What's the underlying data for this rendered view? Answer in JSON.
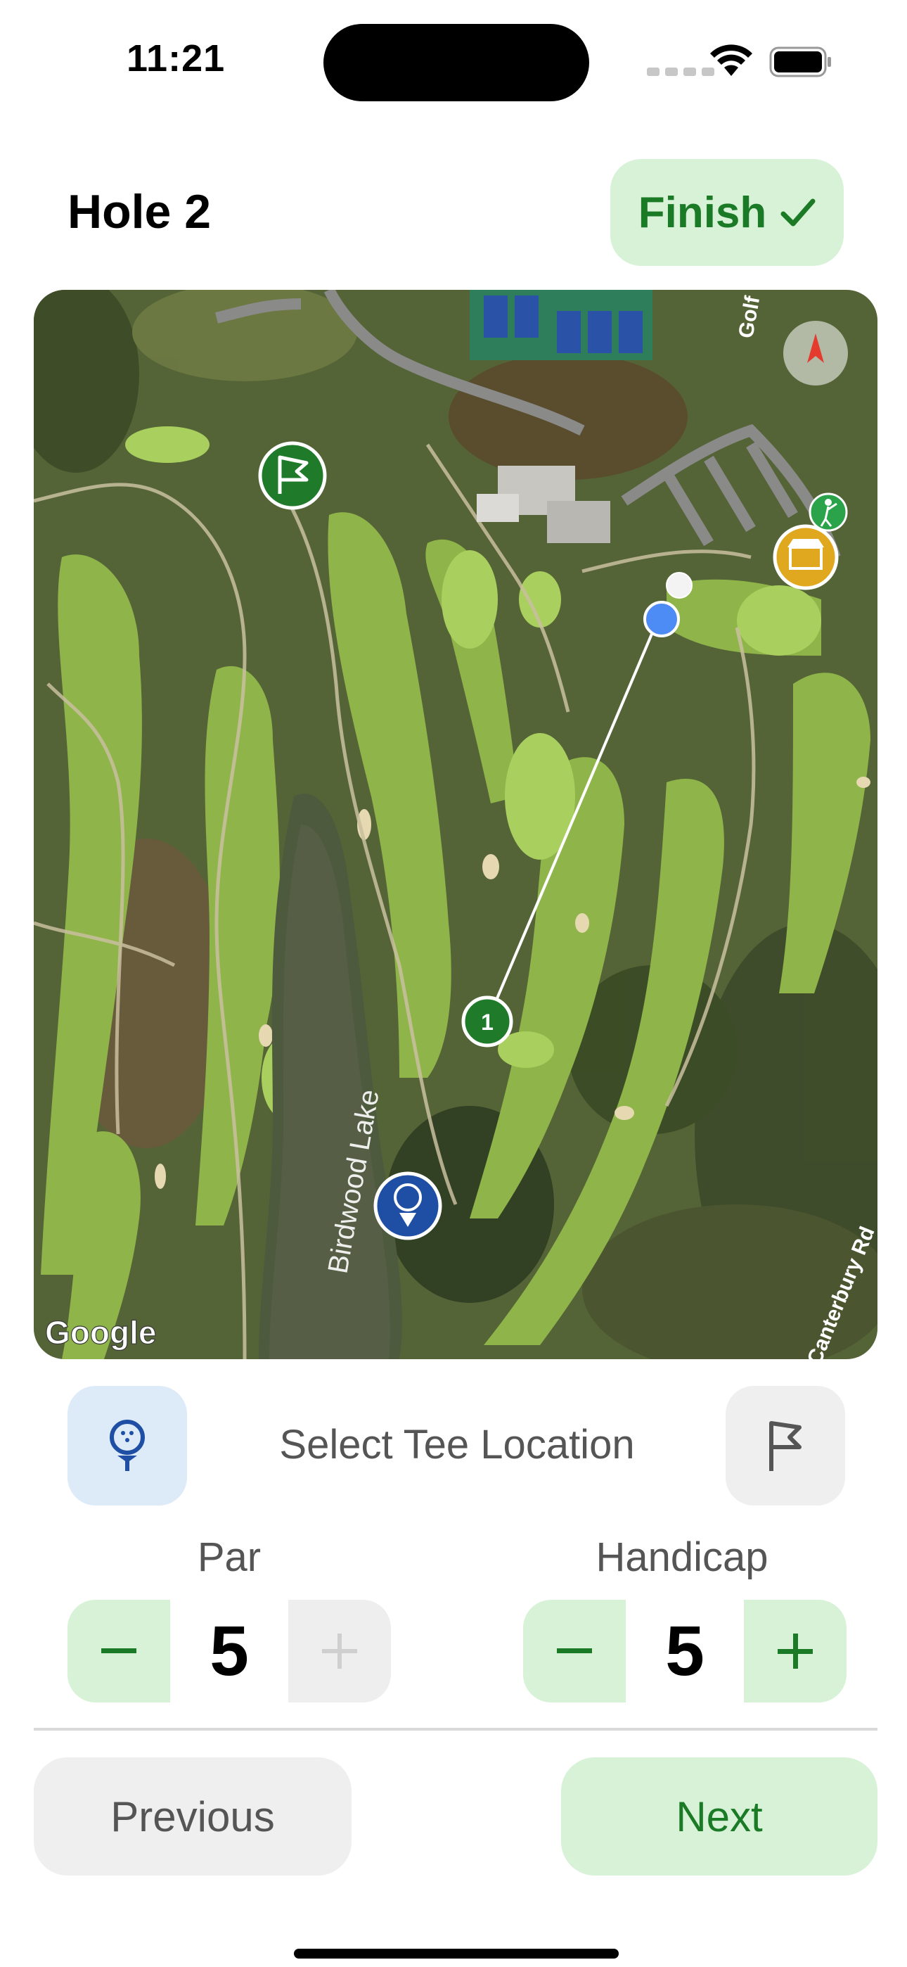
{
  "status_bar": {
    "time": "11:21"
  },
  "header": {
    "title": "Hole 2",
    "finish_label": "Finish"
  },
  "map": {
    "provider_label": "Google",
    "water_label": "Birdwood Lake",
    "road_label_top": "Golf",
    "road_label_right": "Canterbury Rd",
    "shot_marker_number": "1",
    "icons": [
      "compass-icon",
      "pin-flag-icon",
      "golfer-icon",
      "pro-shop-icon",
      "tee-marker-icon",
      "shot-marker",
      "current-location-dot"
    ]
  },
  "controls": {
    "tee_label": "Select Tee Location",
    "par": {
      "label": "Par",
      "value": "5"
    },
    "handicap": {
      "label": "Handicap",
      "value": "5"
    }
  },
  "nav": {
    "previous_label": "Previous",
    "next_label": "Next"
  },
  "colors": {
    "accent_green": "#1b7a25",
    "light_green": "#d7f2d7",
    "tee_blue": "#1f4fa5"
  }
}
